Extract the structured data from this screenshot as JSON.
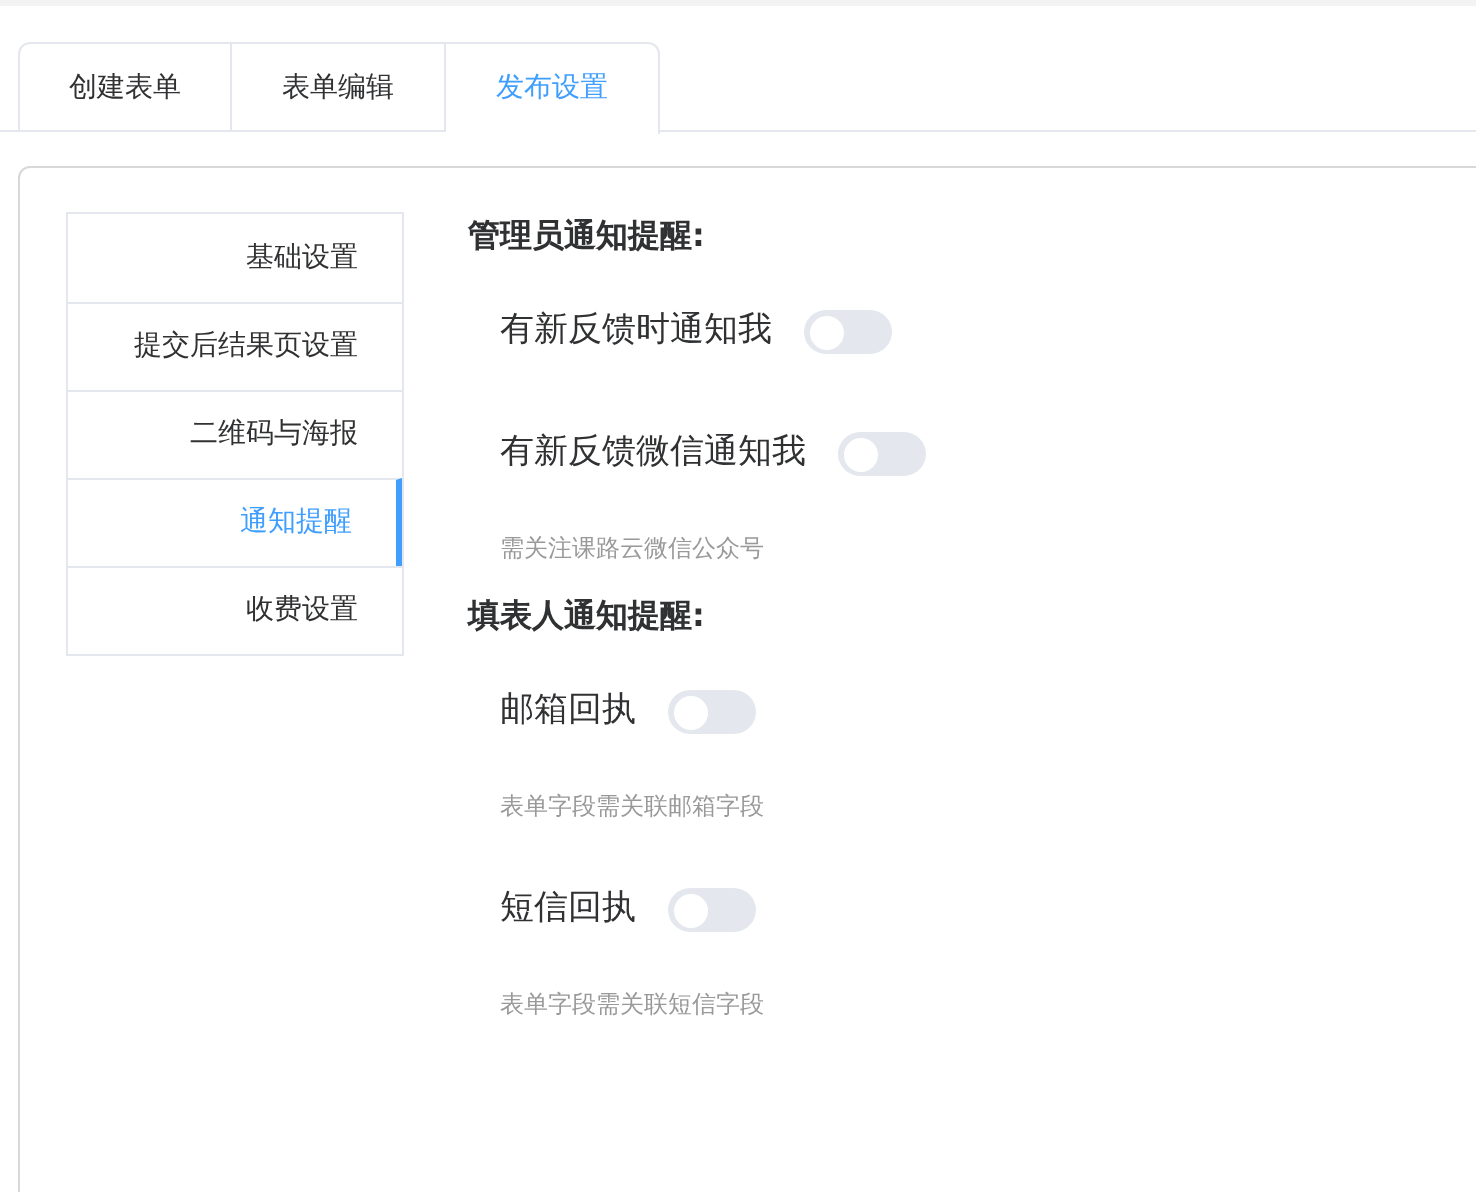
{
  "tabs": [
    {
      "label": "创建表单",
      "selected": false
    },
    {
      "label": "表单编辑",
      "selected": false
    },
    {
      "label": "发布设置",
      "selected": true
    }
  ],
  "side_menu": [
    {
      "label": "基础设置",
      "selected": false
    },
    {
      "label": "提交后结果页设置",
      "selected": false
    },
    {
      "label": "二维码与海报",
      "selected": false
    },
    {
      "label": "通知提醒",
      "selected": true
    },
    {
      "label": "收费设置",
      "selected": false
    }
  ],
  "sections": [
    {
      "heading": "管理员通知提醒:",
      "items": [
        {
          "kind": "toggle",
          "label": "有新反馈时通知我",
          "on": false
        },
        {
          "kind": "toggle",
          "label": "有新反馈微信通知我",
          "on": false
        },
        {
          "kind": "hint",
          "text": "需关注课路云微信公众号"
        }
      ]
    },
    {
      "heading": "填表人通知提醒:",
      "items": [
        {
          "kind": "toggle",
          "label": "邮箱回执",
          "on": false
        },
        {
          "kind": "hint",
          "text": "表单字段需关联邮箱字段"
        },
        {
          "kind": "toggle",
          "label": "短信回执",
          "on": false
        },
        {
          "kind": "hint",
          "text": "表单字段需关联短信字段"
        }
      ]
    }
  ]
}
